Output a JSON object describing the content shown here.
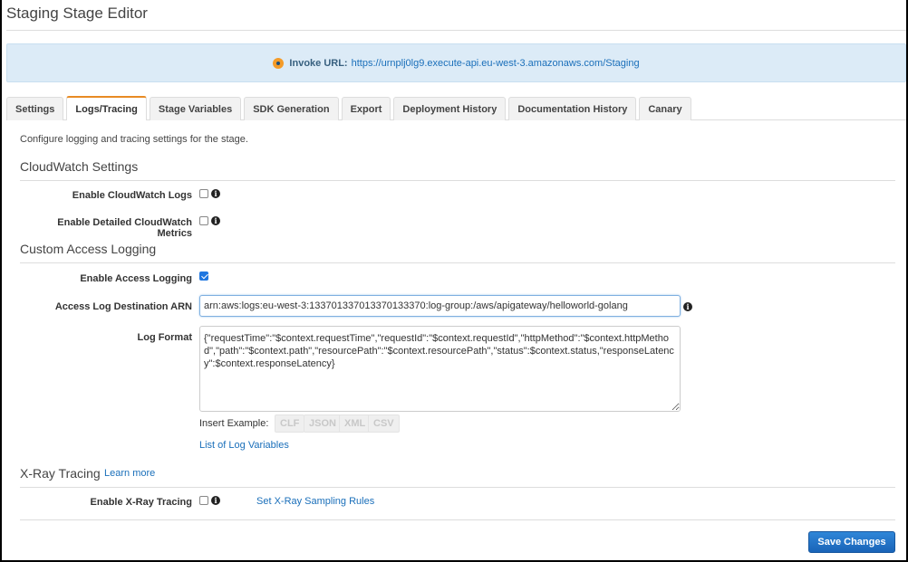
{
  "page": {
    "title": "Staging Stage Editor"
  },
  "invoke": {
    "label": "Invoke URL:",
    "url": "https://urnplj0lg9.execute-api.eu-west-3.amazonaws.com/Staging",
    "dot_color": "#f49b28"
  },
  "tabs": [
    {
      "label": "Settings",
      "active": false
    },
    {
      "label": "Logs/Tracing",
      "active": true
    },
    {
      "label": "Stage Variables",
      "active": false
    },
    {
      "label": "SDK Generation",
      "active": false
    },
    {
      "label": "Export",
      "active": false
    },
    {
      "label": "Deployment History",
      "active": false
    },
    {
      "label": "Documentation History",
      "active": false
    },
    {
      "label": "Canary",
      "active": false
    }
  ],
  "content": {
    "description": "Configure logging and tracing settings for the stage.",
    "cloudwatch": {
      "title": "CloudWatch Settings",
      "enable_logs_label": "Enable CloudWatch Logs",
      "enable_logs_checked": false,
      "detailed_metrics_label": "Enable Detailed CloudWatch Metrics",
      "detailed_metrics_checked": false
    },
    "access_logging": {
      "title": "Custom Access Logging",
      "enable_label": "Enable Access Logging",
      "enable_checked": true,
      "arn_label": "Access Log Destination ARN",
      "arn_value": "arn:aws:logs:eu-west-3:133701337013370133370:log-group:/aws/apigateway/helloworld-golang",
      "format_label": "Log Format",
      "format_value": "{\"requestTime\":\"$context.requestTime\",\"requestId\":\"$context.requestId\",\"httpMethod\":\"$context.httpMethod\",\"path\":\"$context.path\",\"resourcePath\":\"$context.resourcePath\",\"status\":$context.status,\"responseLatency\":$context.responseLatency}",
      "insert_example_label": "Insert Example:",
      "examples": [
        "CLF",
        "JSON",
        "XML",
        "CSV"
      ],
      "log_variables_link": "List of Log Variables"
    },
    "xray": {
      "title": "X-Ray Tracing",
      "learn_more": "Learn more",
      "enable_label": "Enable X-Ray Tracing",
      "enable_checked": false,
      "sampling_rules_link": "Set X-Ray Sampling Rules"
    }
  },
  "footer": {
    "save_label": "Save Changes",
    "accent": "#1a6fba"
  }
}
